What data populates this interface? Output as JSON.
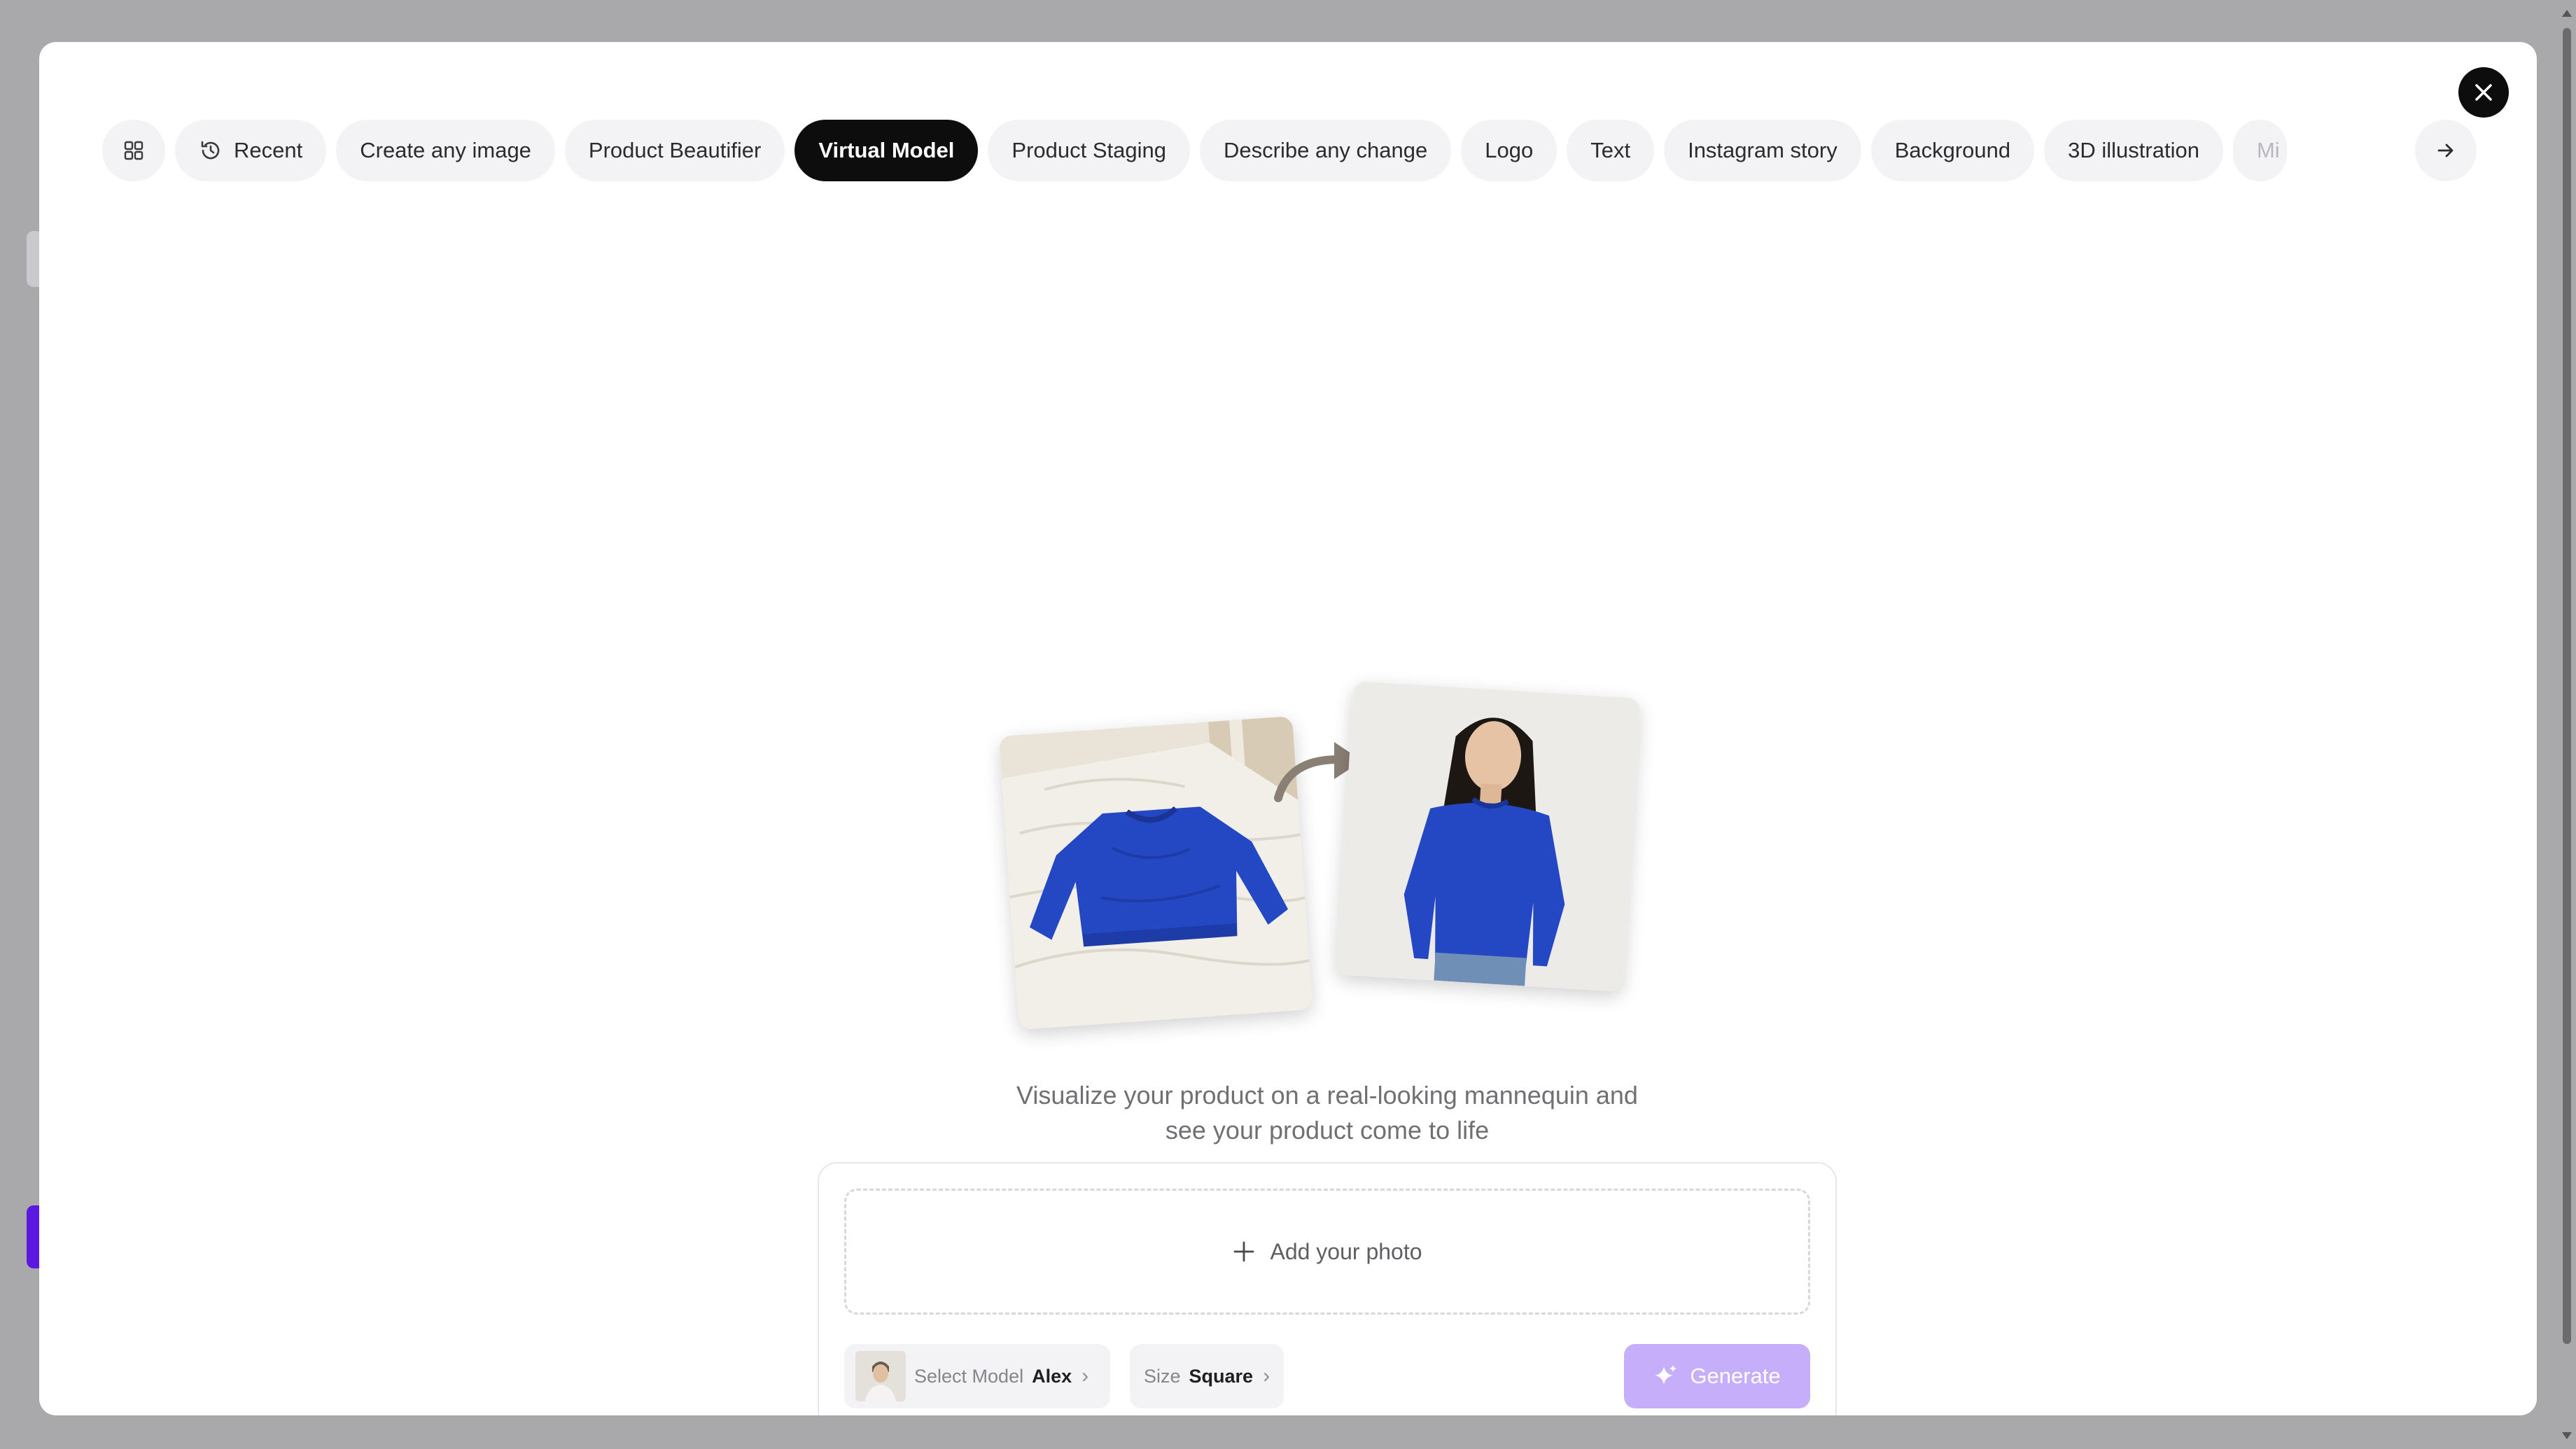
{
  "tabs": [
    {
      "id": "grid",
      "icon": "grid-icon",
      "label": ""
    },
    {
      "id": "recent",
      "icon": "history-icon",
      "label": "Recent"
    },
    {
      "id": "create-any-image",
      "label": "Create any image"
    },
    {
      "id": "product-beautifier",
      "label": "Product Beautifier"
    },
    {
      "id": "virtual-model",
      "label": "Virtual Model",
      "active": true
    },
    {
      "id": "product-staging",
      "label": "Product Staging"
    },
    {
      "id": "describe-any-change",
      "label": "Describe any change"
    },
    {
      "id": "logo",
      "label": "Logo"
    },
    {
      "id": "text",
      "label": "Text"
    },
    {
      "id": "instagram-story",
      "label": "Instagram story"
    },
    {
      "id": "background",
      "label": "Background"
    },
    {
      "id": "3d-illustration",
      "label": "3D illustration"
    },
    {
      "id": "mi",
      "label": "Mi",
      "truncated": true
    }
  ],
  "description": {
    "line1": "Visualize your product on a real-looking mannequin and",
    "line2": "see your product come to life"
  },
  "upload": {
    "label": "Add your photo",
    "icon": "plus-icon"
  },
  "model": {
    "label": "Select Model",
    "value": "Alex"
  },
  "size": {
    "label": "Size",
    "value": "Square"
  },
  "generate": {
    "label": "Generate",
    "icon": "sparkle-icon"
  },
  "colors": {
    "active_tab_bg": "#0d0d0d",
    "tab_bg": "#f3f3f5",
    "generate_bg": "#c7aefa",
    "sweater_blue": "#2448c4"
  }
}
